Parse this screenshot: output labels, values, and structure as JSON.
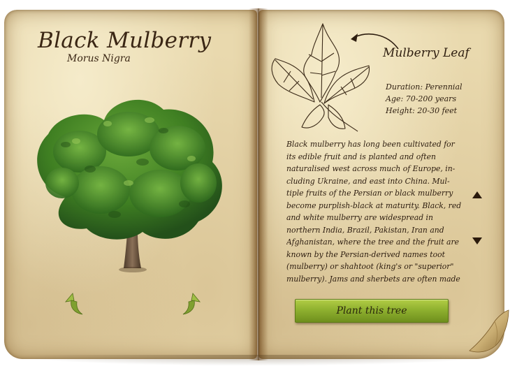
{
  "left_page": {
    "title": "Black Mulberry",
    "subtitle": "Morus Nigra",
    "tree_image_icon": "mulberry-tree-icon",
    "rotate_left_icon": "rotate-left-arrow-icon",
    "rotate_right_icon": "rotate-right-arrow-icon"
  },
  "right_page": {
    "leaf_title": "Mulberry Leaf",
    "leaf_icon": "mulberry-leaf-sketch-icon",
    "facts": {
      "duration": "Duration: Perennial",
      "age": "Age: 70-200 years",
      "height": "Height: 20-30 feet"
    },
    "description": "Black mulberry has long been cultivated for its edible fruit and is planted and often naturalised west across much of Europe, in-cluding Ukraine, and east into China. Mul-tiple fruits of the Persian or black mulberry become purplish-black at maturity. Black, red and white mulberry are widespread in northern India, Brazil, Pakistan, Iran and Afghanistan, where the tree and the fruit are known by the Persian-derived names toot (mulberry) or shahtoot (king's or \"superior\" mulberry). Jams and sherbets are often made",
    "scroll_up_icon": "triangle-up-icon",
    "scroll_down_icon": "triangle-down-icon",
    "plant_button_label": "Plant this tree"
  },
  "colors": {
    "parchment": "#e9d9ae",
    "ink": "#2e1e10",
    "button_green": "#8fb12f",
    "foliage": "#3f7f22",
    "trunk": "#6b5540"
  }
}
